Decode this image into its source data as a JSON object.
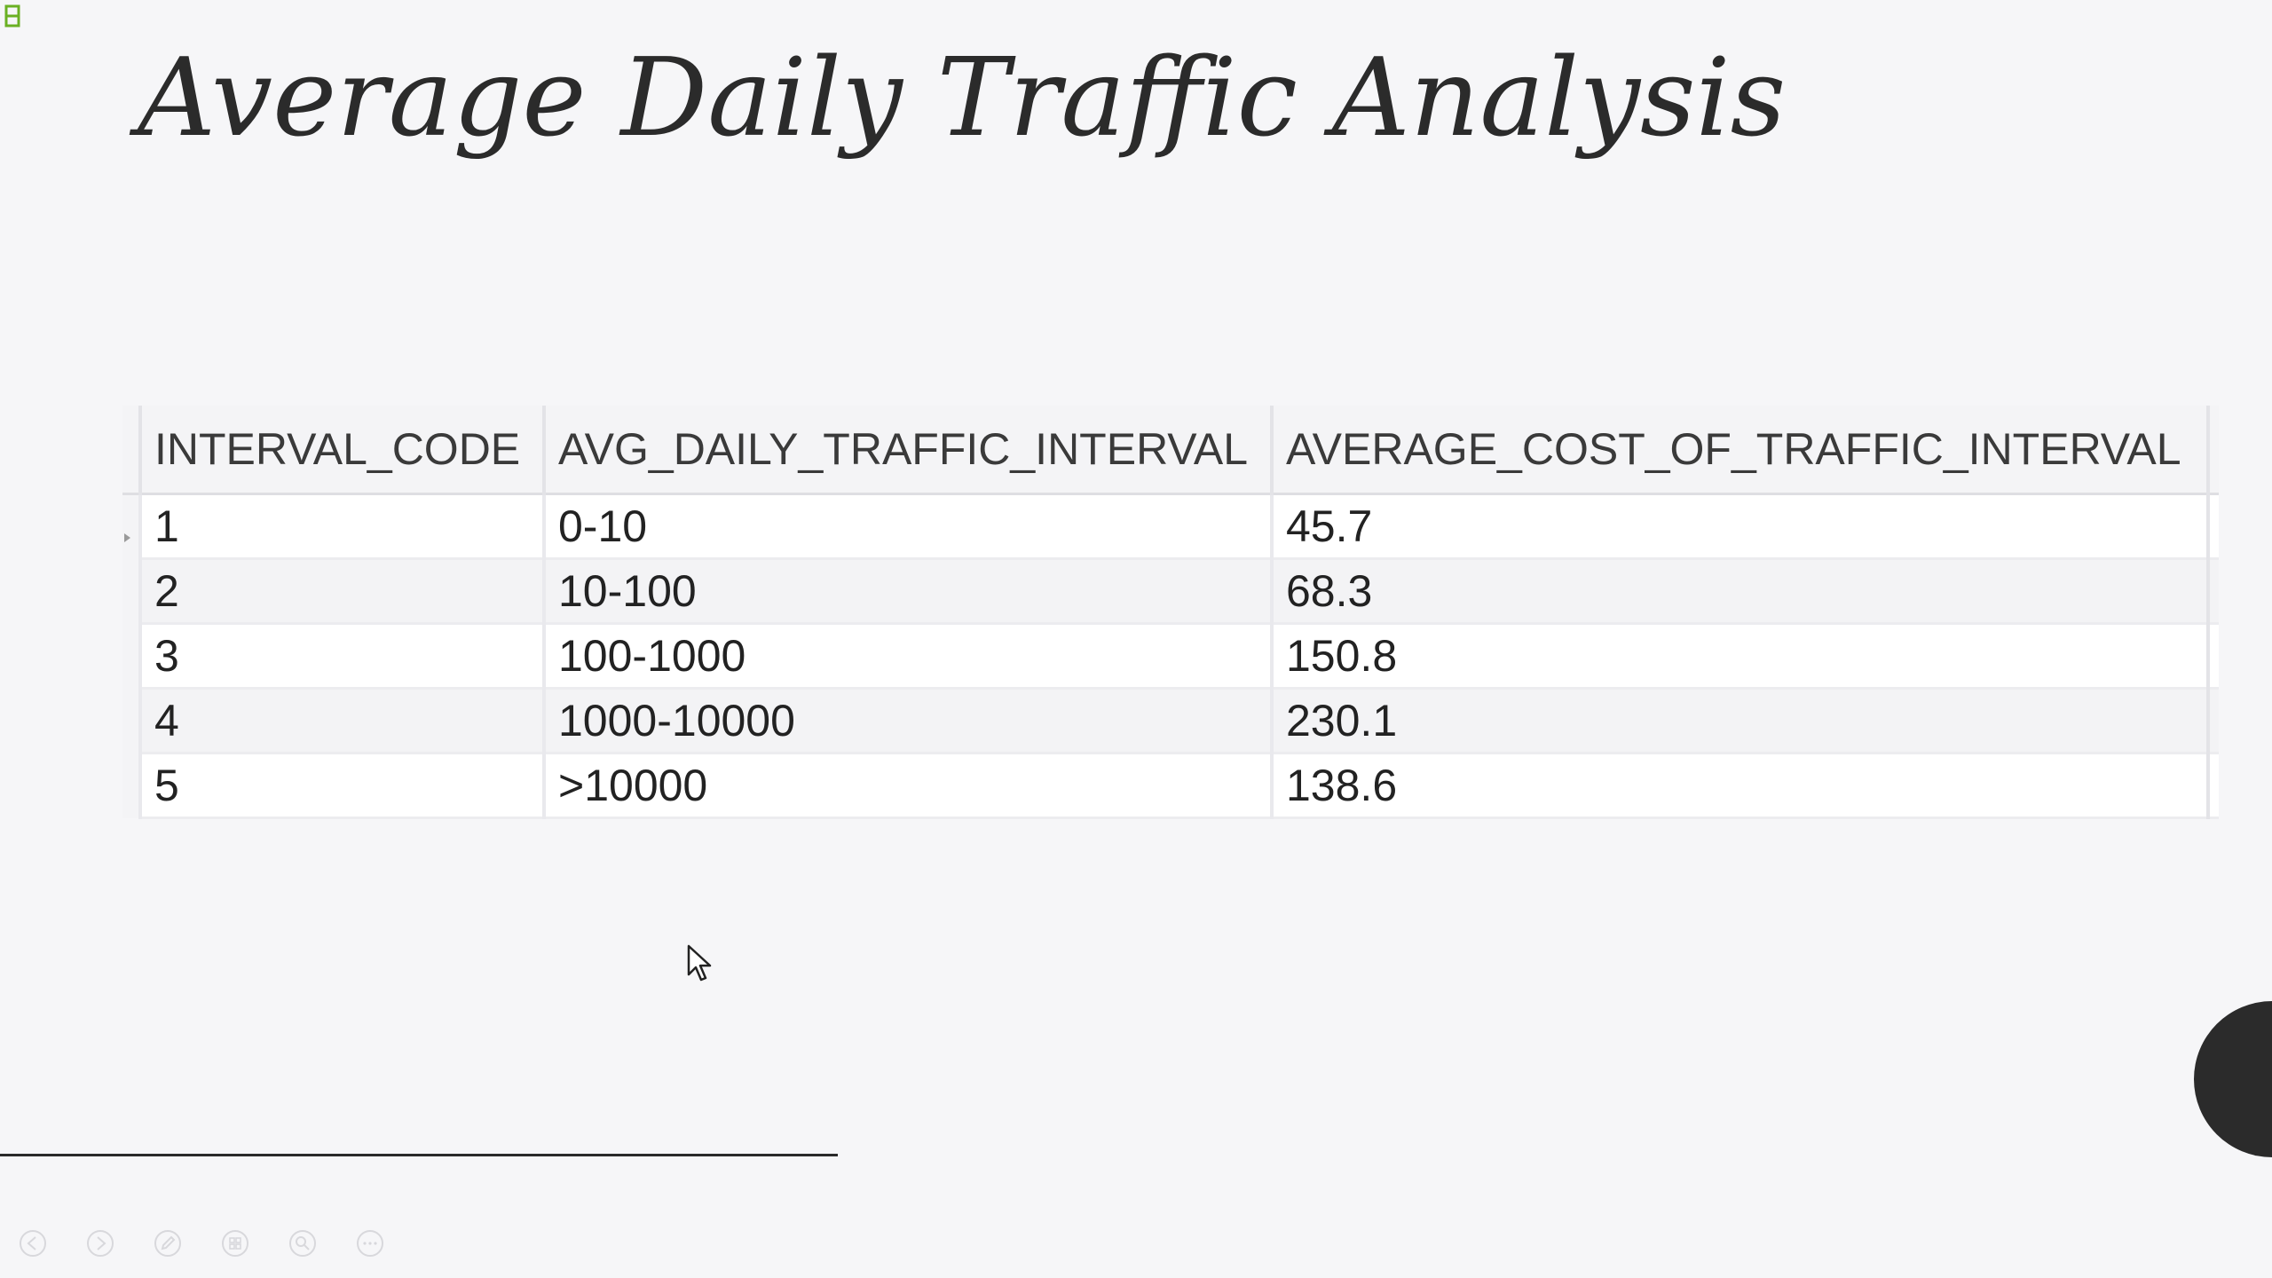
{
  "slide": {
    "title": "Average Daily Traffic Analysis"
  },
  "table": {
    "columns": [
      "INTERVAL_CODE",
      "AVG_DAILY_TRAFFIC_INTERVAL",
      "AVERAGE_COST_OF_TRAFFIC_INTERVAL"
    ],
    "rows": [
      [
        "1",
        "0-10",
        "45.7"
      ],
      [
        "2",
        "10-100",
        "68.3"
      ],
      [
        "3",
        "100-1000",
        "150.8"
      ],
      [
        "4",
        "1000-10000",
        "230.1"
      ],
      [
        "5",
        ">10000",
        "138.6"
      ]
    ]
  },
  "toolbar": {
    "icons": [
      "previous-icon",
      "next-icon",
      "pen-icon",
      "slides-icon",
      "zoom-icon",
      "more-icon"
    ]
  },
  "colors": {
    "background": "#f6f6f8",
    "title_text": "#2b2b2b",
    "corner_icon": "#6ab023",
    "circle": "#2b2b2b"
  }
}
